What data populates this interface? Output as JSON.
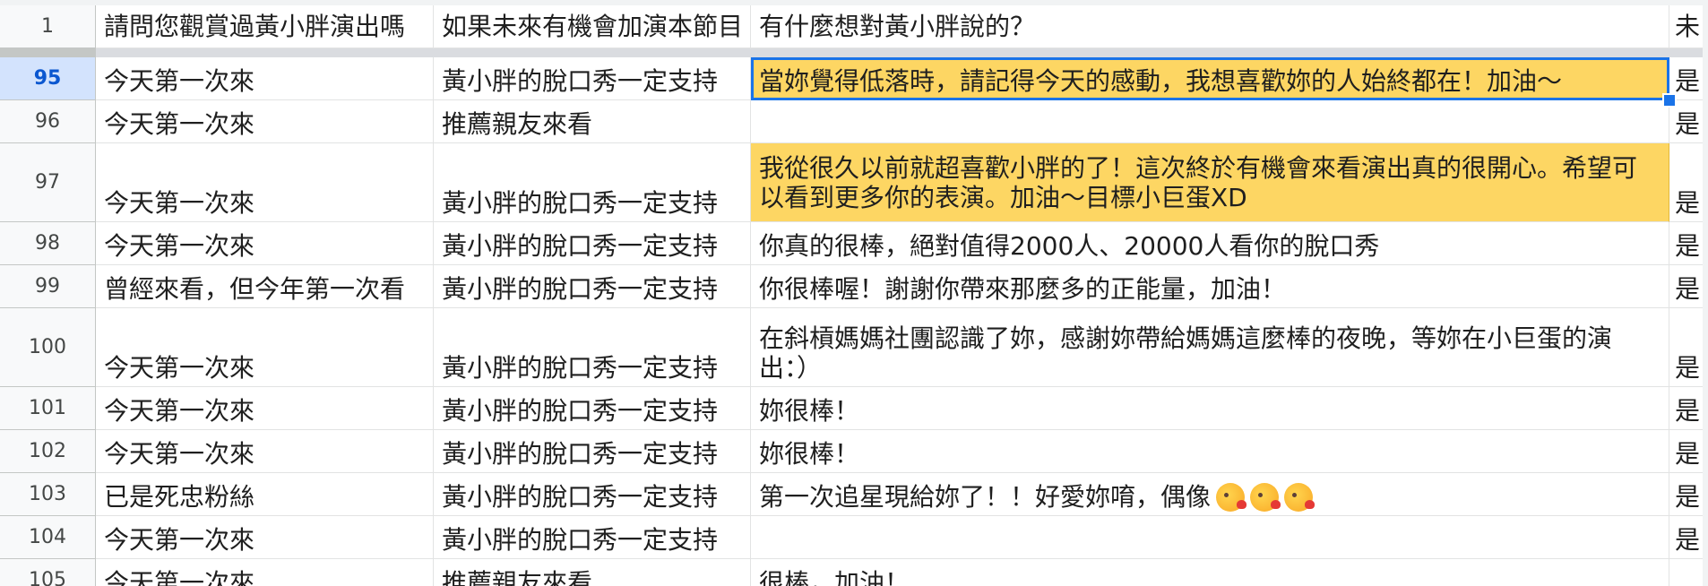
{
  "header_row": {
    "num": "1",
    "col_a": "請問您觀賞過黃小胖演出嗎",
    "col_b": "如果未來有機會加演本節目",
    "col_c": "有什麼想對黃小胖說的？",
    "col_d": "未"
  },
  "rows": [
    {
      "num": "95",
      "a": "今天第一次來",
      "b": "黃小胖的脫口秀一定支持",
      "c": "當妳覺得低落時，請記得今天的感動，我想喜歡妳的人始終都在！加油～",
      "d": "是",
      "highlighted": true,
      "selected": true
    },
    {
      "num": "96",
      "a": "今天第一次來",
      "b": "推薦親友來看",
      "c": "",
      "d": "是"
    },
    {
      "num": "97",
      "a": "今天第一次來",
      "b": "黃小胖的脫口秀一定支持",
      "c": "我從很久以前就超喜歡小胖的了！這次終於有機會來看演出真的很開心。希望可以看到更多你的表演。加油～目標小巨蛋XD",
      "d": "是",
      "highlighted": true
    },
    {
      "num": "98",
      "a": "今天第一次來",
      "b": "黃小胖的脫口秀一定支持",
      "c": "你真的很棒，絕對值得2000人、20000人看你的脫口秀",
      "d": "是"
    },
    {
      "num": "99",
      "a": "曾經來看，但今年第一次看",
      "b": "黃小胖的脫口秀一定支持",
      "c": "你很棒喔！謝謝你帶來那麼多的正能量，加油！",
      "d": "是"
    },
    {
      "num": "100",
      "a": "今天第一次來",
      "b": "黃小胖的脫口秀一定支持",
      "c": "在斜槓媽媽社團認識了妳，感謝妳帶給媽媽這麼棒的夜晚，等妳在小巨蛋的演出：）",
      "d": "是"
    },
    {
      "num": "101",
      "a": "今天第一次來",
      "b": "黃小胖的脫口秀一定支持",
      "c": "妳很棒！",
      "d": "是"
    },
    {
      "num": "102",
      "a": "今天第一次來",
      "b": "黃小胖的脫口秀一定支持",
      "c": "妳很棒！",
      "d": "是"
    },
    {
      "num": "103",
      "a": "已是死忠粉絲",
      "b": "黃小胖的脫口秀一定支持",
      "c": "第一次追星現給妳了！！好愛妳唷，偶像",
      "d": "是",
      "emoji": [
        "kissing-heart-emoji",
        "kissing-heart-emoji",
        "kissing-heart-emoji"
      ]
    },
    {
      "num": "104",
      "a": "今天第一次來",
      "b": "黃小胖的脫口秀一定支持",
      "c": "",
      "d": "是"
    },
    {
      "num": "105",
      "a": "今天第一次來",
      "b": "推薦親友來看",
      "c": "很棒，加油！",
      "d": ""
    }
  ],
  "colors": {
    "highlight": "#fdd663",
    "selection": "#1a73e8",
    "gridline": "#e2e3e3",
    "row_header_bg": "#f8f9fa"
  }
}
